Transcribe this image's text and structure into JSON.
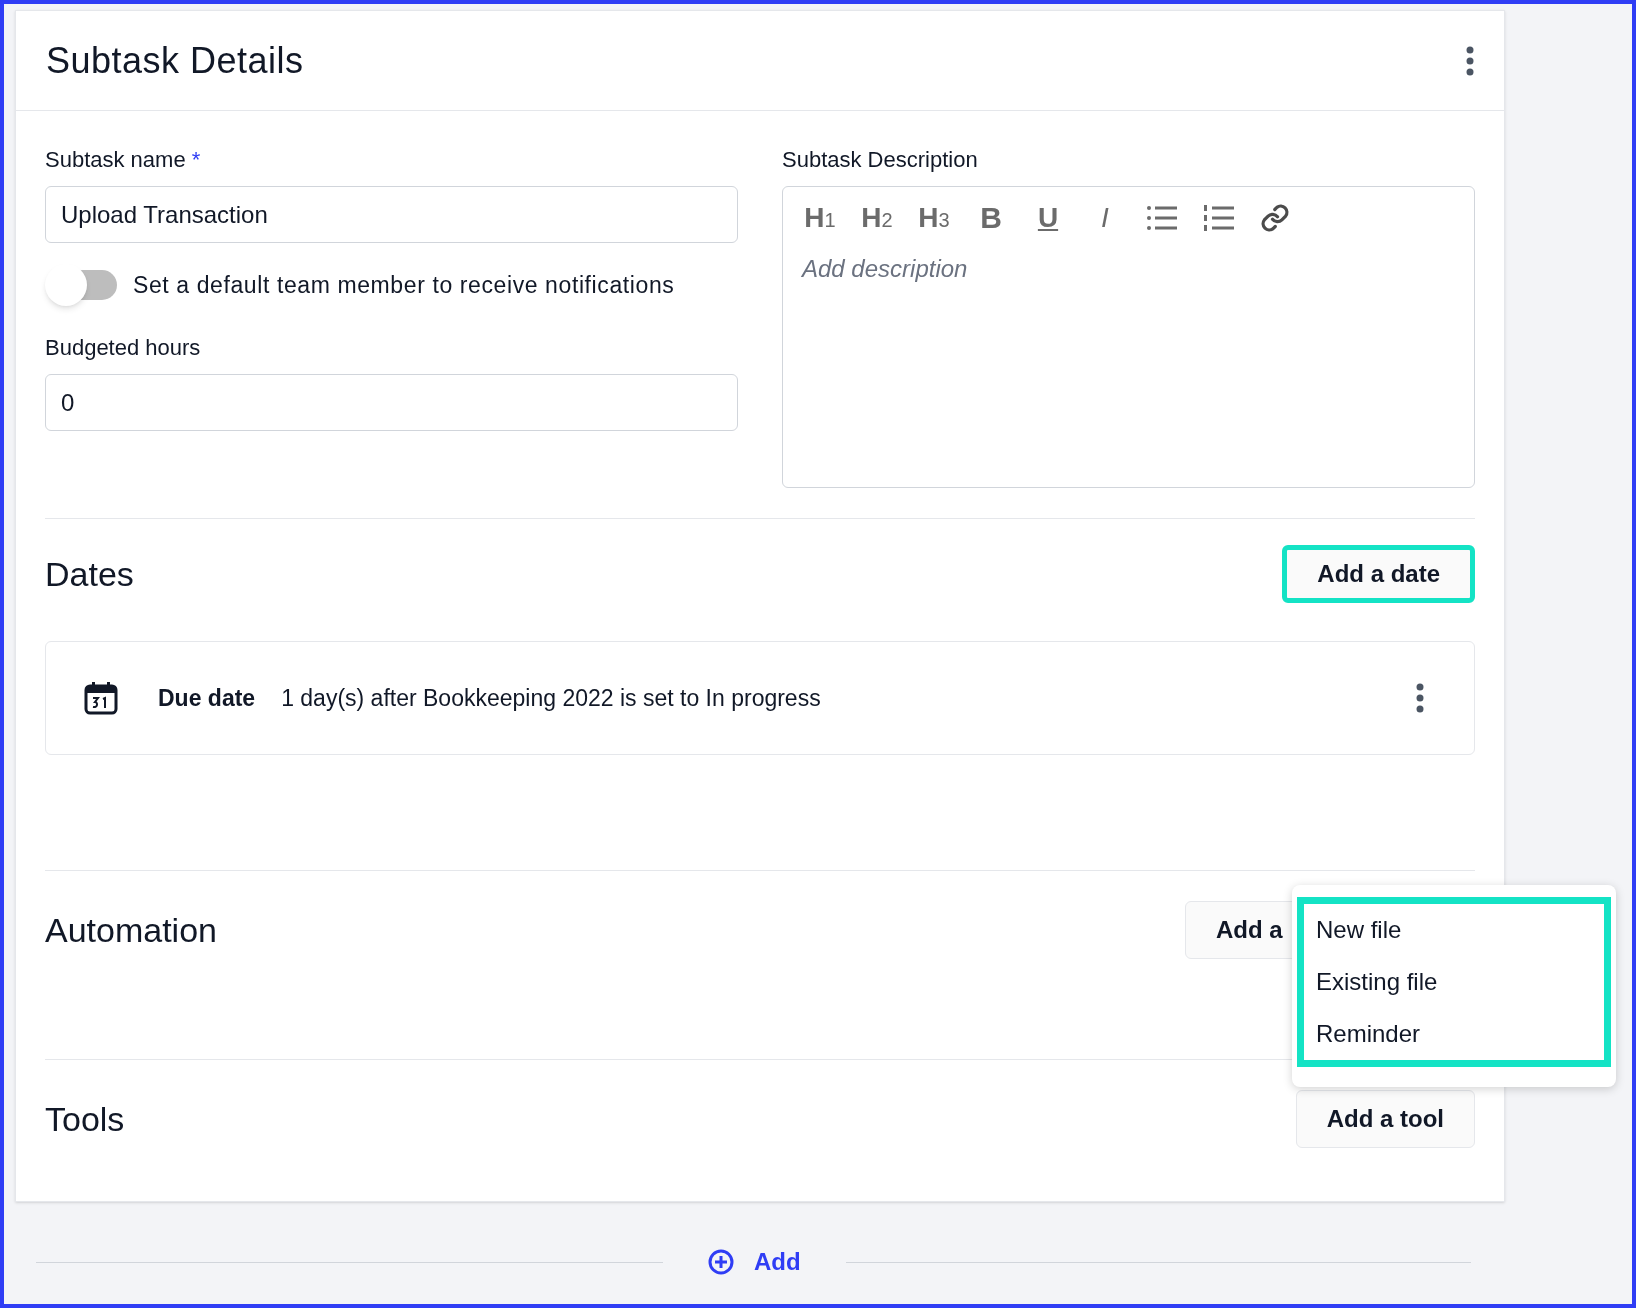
{
  "panel": {
    "title": "Subtask Details"
  },
  "form": {
    "name_label": "Subtask name",
    "required_mark": "*",
    "name_value": "Upload Transaction",
    "notify_toggle": {
      "label": "Set a default team member to receive notifications",
      "on": false
    },
    "hours_label": "Budgeted hours",
    "hours_value": "0",
    "description_label": "Subtask Description",
    "toolbar": [
      {
        "kind": "h",
        "label": "H",
        "sub": "1"
      },
      {
        "kind": "h",
        "label": "H",
        "sub": "2"
      },
      {
        "kind": "h",
        "label": "H",
        "sub": "3"
      },
      {
        "kind": "bold",
        "label": "B"
      },
      {
        "kind": "underline",
        "label": "U"
      },
      {
        "kind": "italic",
        "label": "I"
      },
      {
        "kind": "bullets"
      },
      {
        "kind": "numbers"
      },
      {
        "kind": "link"
      }
    ],
    "description_placeholder": "Add description"
  },
  "dates": {
    "title": "Dates",
    "button": "Add a date",
    "highlighted": true,
    "items": [
      {
        "label": "Due date",
        "text": "1 day(s) after Bookkeeping 2022 is set to In progress"
      }
    ]
  },
  "automation": {
    "title": "Automation",
    "button": "Add a",
    "menu": {
      "highlighted": true,
      "items": [
        "New file",
        "Existing file",
        "Reminder"
      ]
    }
  },
  "tools": {
    "title": "Tools",
    "button": "Add a tool"
  },
  "footer": {
    "add": "Add"
  }
}
